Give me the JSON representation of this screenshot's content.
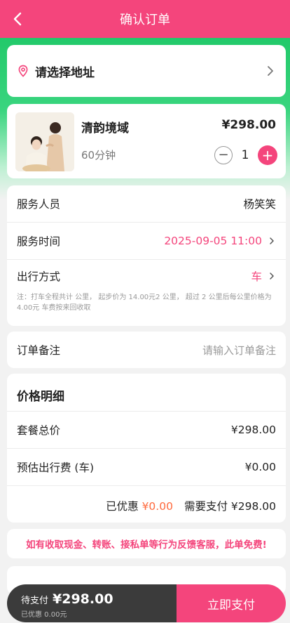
{
  "header": {
    "title": "确认订单"
  },
  "address": {
    "label": "请选择地址"
  },
  "product": {
    "name": "清韵境域",
    "duration": "60分钟",
    "price": "¥298.00",
    "quantity": "1",
    "minus": "−",
    "plus": "+"
  },
  "service": {
    "staff_label": "服务人员",
    "staff_value": "杨笑笑",
    "time_label": "服务时间",
    "time_value": "2025-09-05 11:00",
    "travel_label": "出行方式",
    "travel_value": "车",
    "note": "注：打车全程共计 公里， 起步价为 14.00元2 公里， 超过 2 公里后每公里价格为 4.00元 车费按来回收取"
  },
  "remark": {
    "label": "订单备注",
    "placeholder": "请输入订单备注"
  },
  "price_detail": {
    "title": "价格明细",
    "package_label": "套餐总价",
    "package_value": "¥298.00",
    "travel_fee_label": "预估出行费 (车)",
    "travel_fee_value": "¥0.00",
    "discount_label": "已优惠",
    "discount_value": "¥0.00",
    "pay_label": "需要支付",
    "pay_value": "¥298.00"
  },
  "warning": "如有收取现金、转账、接私单等行为反馈客服，此单免费!",
  "paybar": {
    "due_label": "待支付",
    "due_amount": "¥298.00",
    "discount_text": "已优惠 0.00元",
    "pay_button": "立即支付"
  },
  "colors": {
    "accent": "#f4457c",
    "green": "#22c96a",
    "orange": "#ff6a3d"
  }
}
